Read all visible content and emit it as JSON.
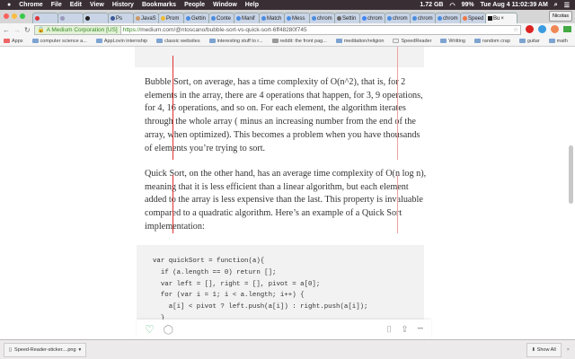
{
  "menubar": {
    "apple": "",
    "items": [
      "Chrome",
      "File",
      "Edit",
      "View",
      "History",
      "Bookmarks",
      "People",
      "Window",
      "Help"
    ],
    "memory": "1.72 GB",
    "battery": "99%",
    "clock": "Tue Aug 4  11:02:39 AM"
  },
  "tabs": [
    "",
    "",
    "",
    "Ps",
    "JavaS",
    "Prom",
    "Gettin",
    "Conte",
    "Manif",
    "Match",
    "Mess",
    "chrom",
    "Settin",
    "chrom",
    "chrom",
    "chrom",
    "chrom",
    "Speed",
    "Bu"
  ],
  "profile": "Nicolas",
  "address": {
    "ev": "A Medium Corporation [US]",
    "scheme": "https://",
    "url": "medium.com/@ntoscano/bubble-sort-vs-quick-sort-6ff48280f745"
  },
  "bookmarks": [
    "Apps",
    "computer science a...",
    "AppLovin internship",
    "classic websites",
    "interesting stuff to r...",
    "reddit: the front pag...",
    "meditation/religion",
    "SpeedReader",
    "Writting",
    "random crap",
    "guitar",
    "math"
  ],
  "article": {
    "p1": "Bubble Sort, on average, has a time complexity of O(n^2), that is, for 2 elements in the array, there are 4 operations that happen, for 3, 9 operations, for 4, 16 operations, and so on. For each element, the algorithm iterates through the whole array ( minus an increasing number from the end of the array, when optimized). This becomes a problem when you have thousands of elements you’re trying to sort.",
    "p2": "Quick Sort, on the other hand, has an average time complexity of O(n log n), meaning that it is less efficient than a linear algorithm, but each element added to the array is less expensive than the last. This property is invaluable compared to a quadratic algorithm. Here’s an example of a Quick Sort implementation:",
    "code": "var quickSort = function(a){\n  if (a.length == 0) return [];\n  var left = [], right = [], pivot = a[0];\n  for (var i = 1; i < a.length; i++) {\n    a[i] < pivot ? left.push(a[i]) : right.push(a[i]);\n  }\n  return quickSort(left).concat(pivot, quickSort(right));"
  },
  "actions": {
    "heart": "♡",
    "comment": "◯",
    "bookmark": "⌷",
    "share": "⇪",
    "more": "•••"
  },
  "shelf": {
    "file": "Speed-Reader-sticker....png",
    "show_all": "Show All",
    "close": "×"
  }
}
